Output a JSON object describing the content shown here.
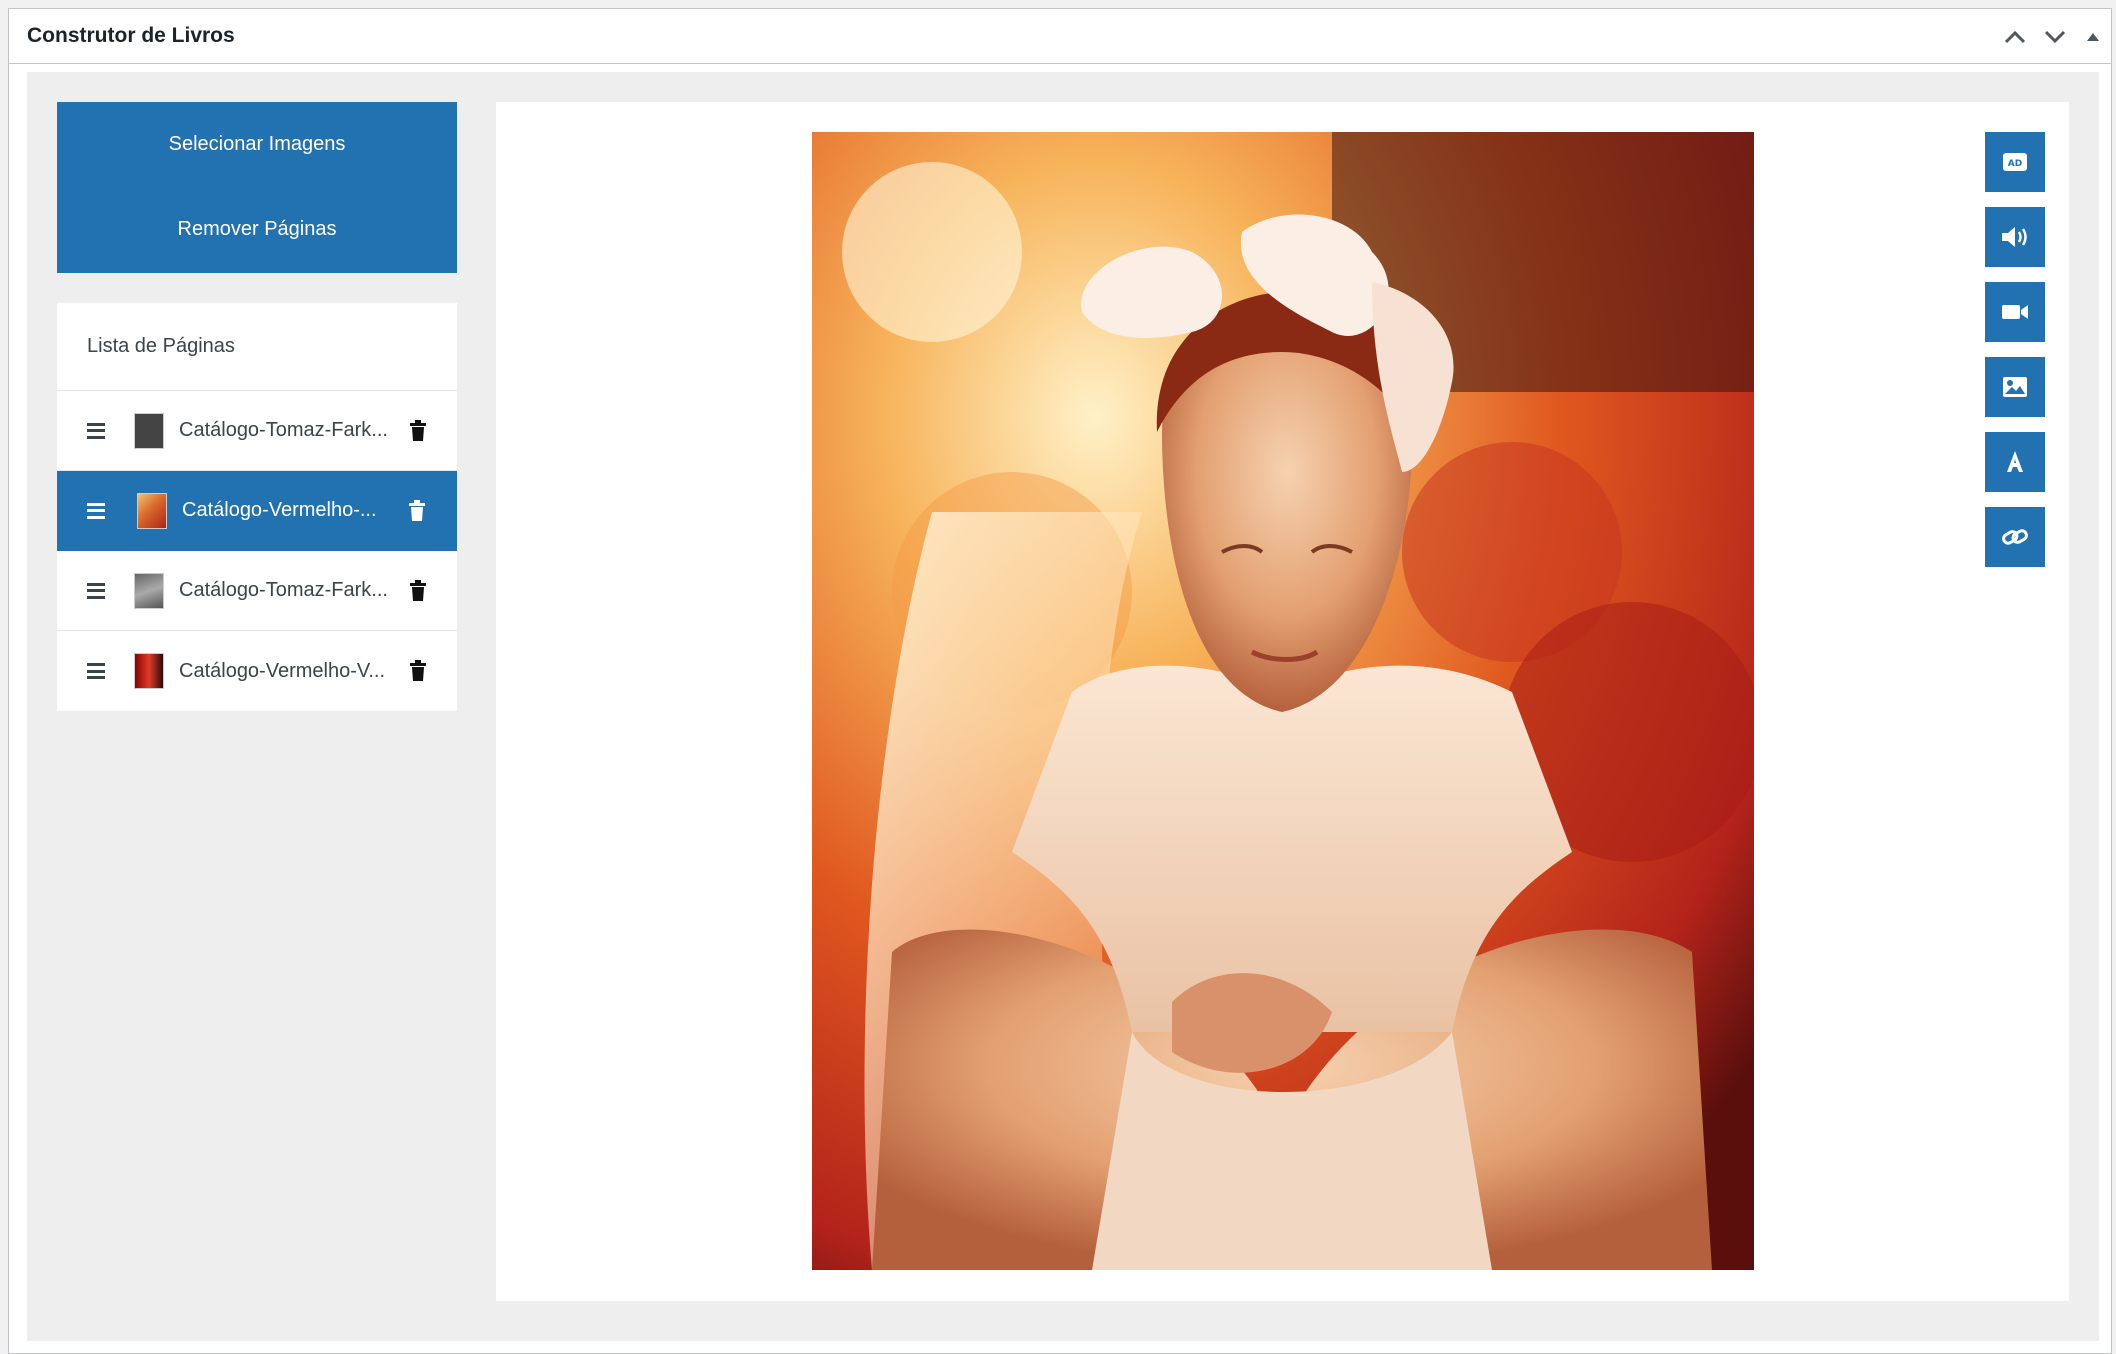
{
  "metabox": {
    "title": "Construtor de Livros",
    "controls": [
      "chevron-up-icon",
      "chevron-down-icon",
      "triangle-up-icon"
    ]
  },
  "sidebar": {
    "select_images_label": "Selecionar Imagens",
    "remove_pages_label": "Remover Páginas",
    "pages_title": "Lista de Páginas",
    "pages": [
      {
        "name": "Catálogo-Tomaz-Fark...",
        "active": false,
        "thumb": "dark-gray"
      },
      {
        "name": "Catálogo-Vermelho-...",
        "active": true,
        "thumb": "orange-photo"
      },
      {
        "name": "Catálogo-Tomaz-Fark...",
        "active": false,
        "thumb": "gray-photo"
      },
      {
        "name": "Catálogo-Vermelho-V...",
        "active": false,
        "thumb": "red-photo"
      }
    ]
  },
  "toolbar": {
    "tools": [
      "ad-icon",
      "audio-icon",
      "video-icon",
      "image-icon",
      "text-icon",
      "link-icon"
    ]
  },
  "colors": {
    "accent": "#2271b1",
    "inside_bg": "#eeeeee"
  }
}
